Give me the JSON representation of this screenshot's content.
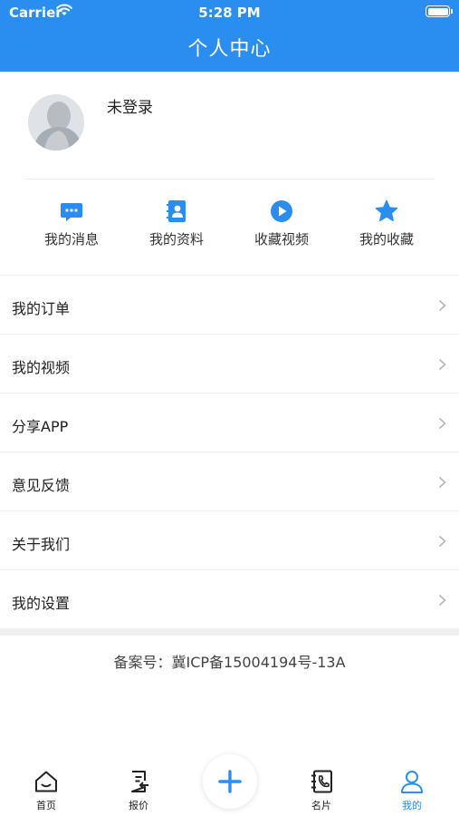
{
  "status_bar": {
    "carrier": "Carrier",
    "time": "5:28 PM"
  },
  "header": {
    "title": "个人中心"
  },
  "profile": {
    "username": "未登录"
  },
  "quick_actions": [
    {
      "label": "我的消息",
      "icon": "message-icon"
    },
    {
      "label": "我的资料",
      "icon": "profile-card-icon"
    },
    {
      "label": "收藏视频",
      "icon": "play-icon"
    },
    {
      "label": "我的收藏",
      "icon": "star-icon"
    }
  ],
  "menu": [
    {
      "label": "我的订单"
    },
    {
      "label": "我的视频"
    },
    {
      "label": "分享APP"
    },
    {
      "label": "意见反馈"
    },
    {
      "label": "关于我们"
    },
    {
      "label": "我的设置"
    }
  ],
  "footer": {
    "icp": "备案号：冀ICP备15004194号-13A"
  },
  "tab_bar": [
    {
      "label": "首页",
      "icon": "home-icon",
      "active": false
    },
    {
      "label": "报价",
      "icon": "quote-document-icon",
      "active": false
    },
    {
      "label": "",
      "icon": "plus-icon",
      "active": false
    },
    {
      "label": "名片",
      "icon": "business-card-phone-icon",
      "active": false
    },
    {
      "label": "我的",
      "icon": "user-icon",
      "active": true
    }
  ],
  "colors": {
    "accent": "#2a8ef0",
    "divider": "#f0f0f0",
    "text": "#222222"
  }
}
